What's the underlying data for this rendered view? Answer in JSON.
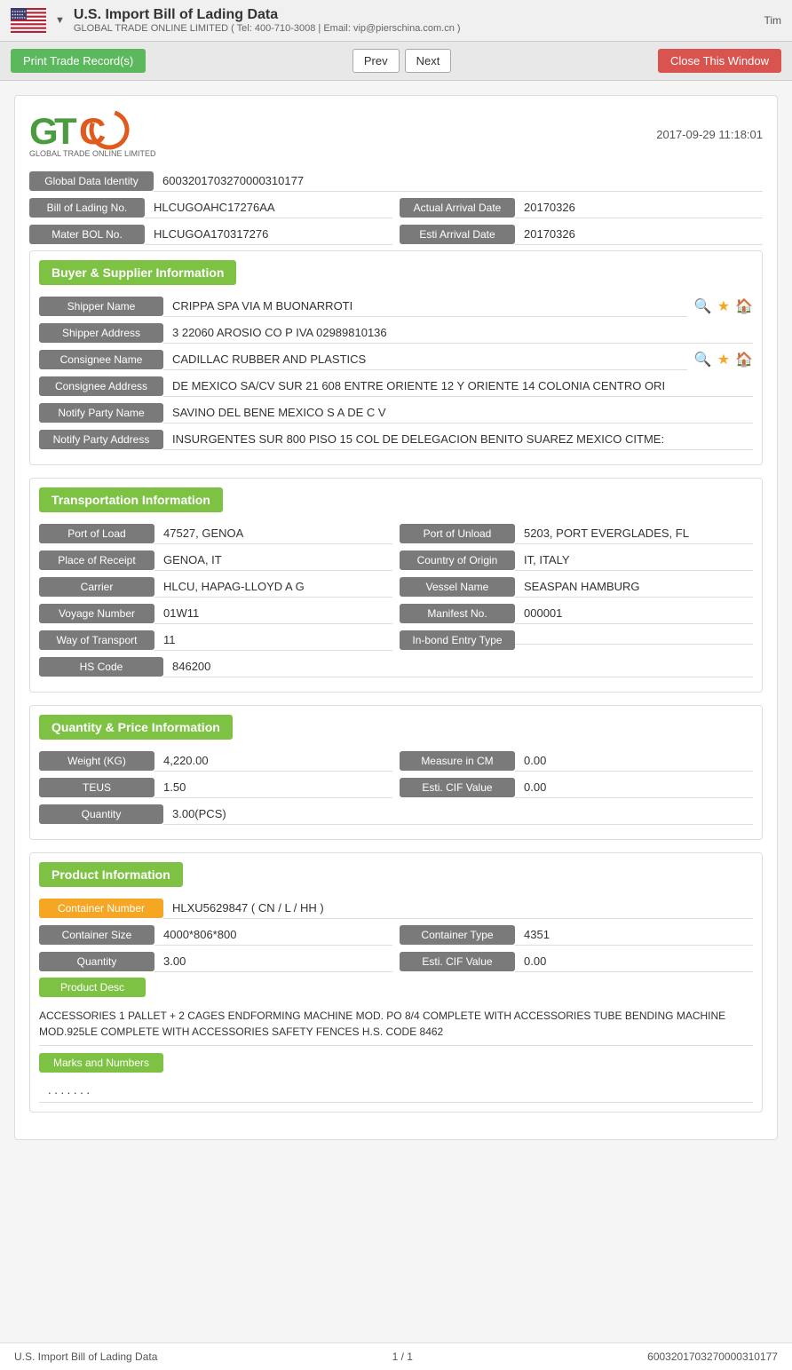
{
  "topbar": {
    "app_title": "U.S. Import Bill of Lading Data",
    "dropdown_arrow": "▼",
    "company_info": "GLOBAL TRADE ONLINE LIMITED ( Tel: 400-710-3008 | Email: vip@pierschina.com.cn )",
    "top_right": "Tim"
  },
  "toolbar": {
    "print_label": "Print Trade Record(s)",
    "prev_label": "Prev",
    "next_label": "Next",
    "close_label": "Close This Window"
  },
  "record": {
    "date": "2017-09-29 11:18:01",
    "logo_company": "GLOBAL TRADE ONLINE LIMITED",
    "global_data_identity_label": "Global Data Identity",
    "global_data_identity_value": "6003201703270000310177",
    "bill_of_lading_no_label": "Bill of Lading No.",
    "bill_of_lading_no_value": "HLCUGOAHC17276AA",
    "actual_arrival_date_label": "Actual Arrival Date",
    "actual_arrival_date_value": "20170326",
    "mater_bol_no_label": "Mater BOL No.",
    "mater_bol_no_value": "HLCUGOA170317276",
    "esti_arrival_date_label": "Esti Arrival Date",
    "esti_arrival_date_value": "20170326"
  },
  "buyer_supplier": {
    "section_title": "Buyer & Supplier Information",
    "shipper_name_label": "Shipper Name",
    "shipper_name_value": "CRIPPA SPA VIA M BUONARROTI",
    "shipper_address_label": "Shipper Address",
    "shipper_address_value": "3 22060 AROSIO CO P IVA 02989810136",
    "consignee_name_label": "Consignee Name",
    "consignee_name_value": "CADILLAC RUBBER AND PLASTICS",
    "consignee_address_label": "Consignee Address",
    "consignee_address_value": "DE MEXICO SA/CV SUR 21 608 ENTRE ORIENTE 12 Y ORIENTE 14 COLONIA CENTRO ORI",
    "notify_party_name_label": "Notify Party Name",
    "notify_party_name_value": "SAVINO DEL BENE MEXICO S A DE C V",
    "notify_party_address_label": "Notify Party Address",
    "notify_party_address_value": "INSURGENTES SUR 800 PISO 15 COL DE DELEGACION BENITO SUAREZ MEXICO CITME:"
  },
  "transportation": {
    "section_title": "Transportation Information",
    "port_of_load_label": "Port of Load",
    "port_of_load_value": "47527, GENOA",
    "port_of_unload_label": "Port of Unload",
    "port_of_unload_value": "5203, PORT EVERGLADES, FL",
    "place_of_receipt_label": "Place of Receipt",
    "place_of_receipt_value": "GENOA, IT",
    "country_of_origin_label": "Country of Origin",
    "country_of_origin_value": "IT, ITALY",
    "carrier_label": "Carrier",
    "carrier_value": "HLCU, HAPAG-LLOYD A G",
    "vessel_name_label": "Vessel Name",
    "vessel_name_value": "SEASPAN HAMBURG",
    "voyage_number_label": "Voyage Number",
    "voyage_number_value": "01W11",
    "manifest_no_label": "Manifest No.",
    "manifest_no_value": "000001",
    "way_of_transport_label": "Way of Transport",
    "way_of_transport_value": "11",
    "inbond_entry_type_label": "In-bond Entry Type",
    "inbond_entry_type_value": "",
    "hs_code_label": "HS Code",
    "hs_code_value": "846200"
  },
  "quantity_price": {
    "section_title": "Quantity & Price Information",
    "weight_kg_label": "Weight (KG)",
    "weight_kg_value": "4,220.00",
    "measure_in_cm_label": "Measure in CM",
    "measure_in_cm_value": "0.00",
    "teus_label": "TEUS",
    "teus_value": "1.50",
    "esti_cif_value_label": "Esti. CIF Value",
    "esti_cif_value_value": "0.00",
    "quantity_label": "Quantity",
    "quantity_value": "3.00(PCS)"
  },
  "product_info": {
    "section_title": "Product Information",
    "container_number_label": "Container Number",
    "container_number_value": "HLXU5629847 ( CN / L / HH )",
    "container_size_label": "Container Size",
    "container_size_value": "4000*806*800",
    "container_type_label": "Container Type",
    "container_type_value": "4351",
    "quantity_label": "Quantity",
    "quantity_value": "3.00",
    "esti_cif_value_label": "Esti. CIF Value",
    "esti_cif_value_value": "0.00",
    "product_desc_label": "Product Desc",
    "product_desc_text": "ACCESSORIES 1 PALLET + 2 CAGES ENDFORMING MACHINE MOD. PO 8/4 COMPLETE WITH ACCESSORIES TUBE BENDING MACHINE MOD.925LE COMPLETE WITH ACCESSORIES SAFETY FENCES H.S. CODE 8462",
    "marks_and_numbers_label": "Marks and Numbers",
    "marks_and_numbers_value": ". . . . . . ."
  },
  "footer": {
    "app_title": "U.S. Import Bill of Lading Data",
    "page_info": "1 / 1",
    "record_id": "6003201703270000310177"
  }
}
